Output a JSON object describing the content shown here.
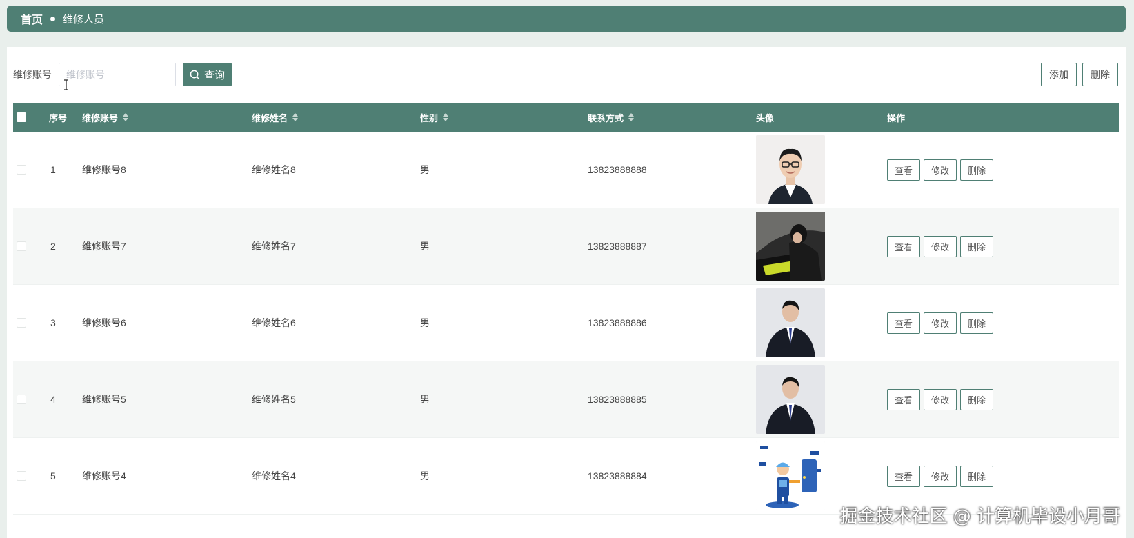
{
  "breadcrumb": {
    "home": "首页",
    "current": "维修人员"
  },
  "search": {
    "label": "维修账号",
    "placeholder": "维修账号",
    "value": "",
    "button": "查询"
  },
  "actions": {
    "add": "添加",
    "delete": "删除"
  },
  "columns": {
    "index": "序号",
    "account": "维修账号",
    "name": "维修姓名",
    "gender": "性别",
    "contact": "联系方式",
    "avatar": "头像",
    "ops": "操作"
  },
  "row_actions": {
    "view": "查看",
    "edit": "修改",
    "delete": "删除"
  },
  "rows": [
    {
      "index": "1",
      "account": "维修账号8",
      "name": "维修姓名8",
      "gender": "男",
      "contact": "13823888888",
      "avatar": "portrait-glasses"
    },
    {
      "index": "2",
      "account": "维修账号7",
      "name": "维修姓名7",
      "gender": "男",
      "contact": "13823888887",
      "avatar": "portrait-car"
    },
    {
      "index": "3",
      "account": "维修账号6",
      "name": "维修姓名6",
      "gender": "男",
      "contact": "13823888886",
      "avatar": "portrait-suit"
    },
    {
      "index": "4",
      "account": "维修账号5",
      "name": "维修姓名5",
      "gender": "男",
      "contact": "13823888885",
      "avatar": "portrait-suit"
    },
    {
      "index": "5",
      "account": "维修账号4",
      "name": "维修姓名4",
      "gender": "男",
      "contact": "13823888884",
      "avatar": "cartoon-repairman"
    }
  ],
  "watermark": "掘金技术社区 @ 计算机毕设小月哥",
  "colors": {
    "primary": "#4f7f74",
    "background": "#e9efec"
  }
}
